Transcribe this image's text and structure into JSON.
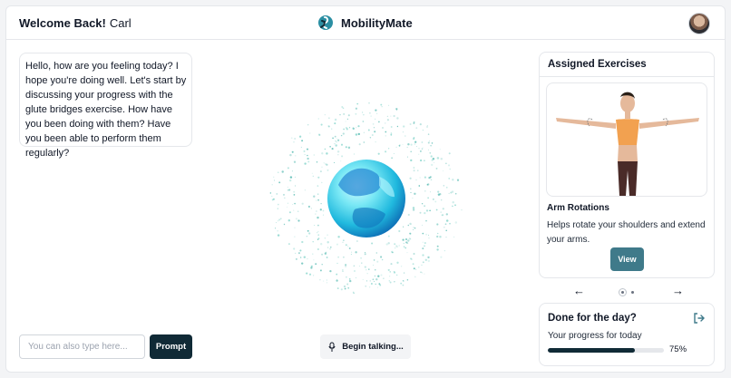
{
  "header": {
    "welcome_label": "Welcome Back!",
    "user_name": "Carl",
    "app_name": "MobilityMate",
    "avatar_icon": "user-avatar",
    "logo_icon": "mobilitymate-logo"
  },
  "chat": {
    "message": "Hello, how are you feeling today? I hope you're doing well. Let's start by discussing your progress with the glute bridges exercise. How have you been doing with them? Have you been able to perform them regularly?"
  },
  "exercises": {
    "title": "Assigned Exercises",
    "items": [
      {
        "name": "Arm Rotations",
        "description": "Helps rotate your shoulders and extend your arms.",
        "action": "View"
      }
    ],
    "prev_icon": "←",
    "next_icon": "→",
    "current_index": 1,
    "total_count": 2
  },
  "progress": {
    "title": "Done for the day?",
    "label": "Your progress for today",
    "percent_text": "75%",
    "value": 0.75,
    "exit_icon": "logout-icon"
  },
  "composer": {
    "placeholder": "You can also type here...",
    "prompt_label": "Prompt",
    "talk_label": "Begin talking...",
    "mic_icon": "microphone-icon"
  },
  "colors": {
    "accent": "#3f7a8a",
    "dark": "#102a36",
    "orb": "#2ec7e4"
  }
}
